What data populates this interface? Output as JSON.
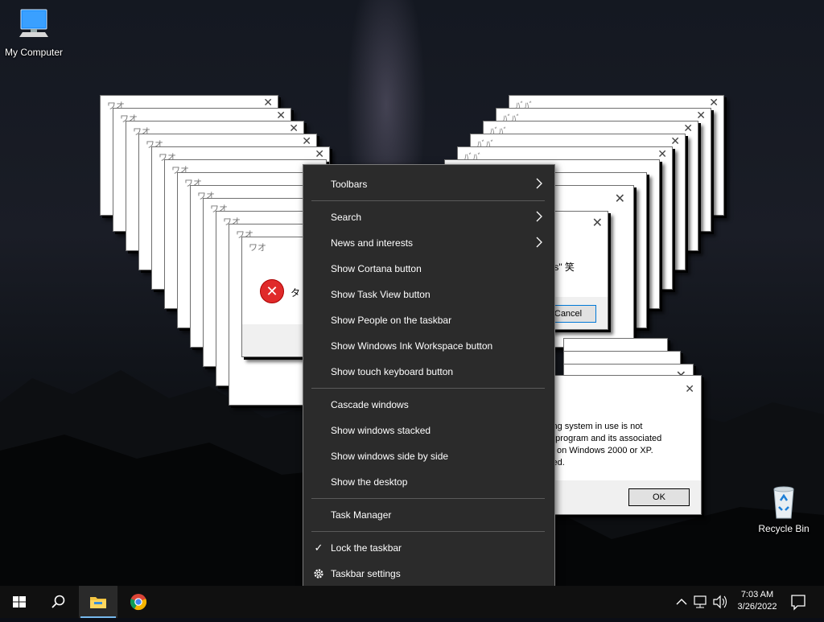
{
  "desktop": {
    "icons": [
      {
        "label": "My Computer",
        "icon": "computer-icon"
      },
      {
        "label": "Recycle Bin",
        "icon": "recycle-bin-icon"
      }
    ]
  },
  "dialogs": {
    "caption_jp": "ワオ",
    "caption_jp_short": "ﾊﾞﾊﾞ",
    "main_left": {
      "caption": "ワオ",
      "message_fragment": "タ"
    },
    "right_small": {
      "message_fragment": "les\" 笑",
      "cancel_label": "Cancel"
    },
    "bottom_right": {
      "lines": [
        "ting system in use is not",
        "p program and its associated",
        "ly on Windows 2000 or XP.",
        "ited."
      ],
      "ok_label": "OK"
    }
  },
  "context_menu": {
    "items": [
      {
        "label": "Toolbars",
        "submenu": true
      },
      {
        "label": "Search",
        "submenu": true
      },
      {
        "label": "News and interests",
        "submenu": true
      },
      {
        "label": "Show Cortana button"
      },
      {
        "label": "Show Task View button"
      },
      {
        "label": "Show People on the taskbar"
      },
      {
        "label": "Show Windows Ink Workspace button"
      },
      {
        "label": "Show touch keyboard button"
      },
      {
        "label": "Cascade windows"
      },
      {
        "label": "Show windows stacked"
      },
      {
        "label": "Show windows side by side"
      },
      {
        "label": "Show the desktop"
      },
      {
        "label": "Task Manager"
      },
      {
        "label": "Lock the taskbar",
        "checked": true
      },
      {
        "label": "Taskbar settings",
        "icon": "gear-icon"
      }
    ]
  },
  "taskbar": {
    "time": "7:03 AM",
    "date": "3/26/2022",
    "accent_color": "#0078d7",
    "pinned": [
      "start-icon",
      "search-icon",
      "file-explorer-icon",
      "chrome-icon"
    ]
  }
}
